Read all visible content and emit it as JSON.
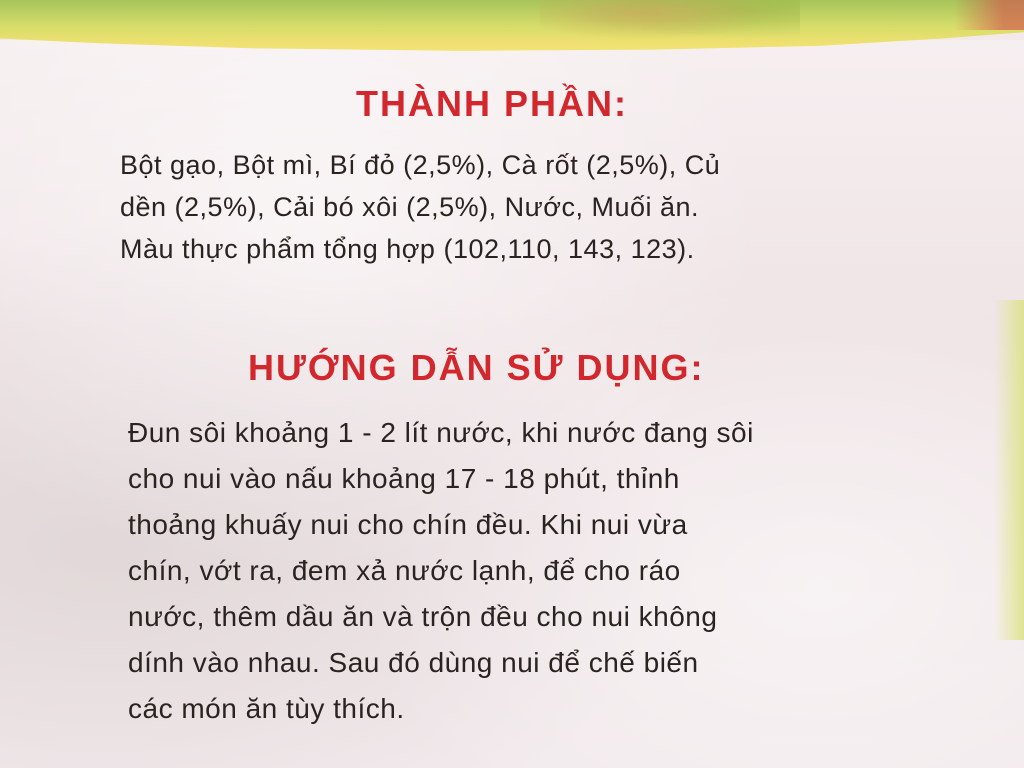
{
  "ingredients": {
    "title": "THÀNH PHẦN:",
    "lines": [
      "Bột gạo, Bột mì, Bí đỏ (2,5%), Cà rốt (2,5%), Củ",
      "dền (2,5%), Cải bó xôi (2,5%), Nước, Muối ăn.",
      "Màu thực phẩm tổng hợp (102,110, 143, 123)."
    ]
  },
  "instructions": {
    "title": "HƯỚNG DẪN SỬ DỤNG:",
    "lines": [
      "Đun sôi khoảng 1 - 2 lít nước, khi nước đang sôi",
      "cho nui vào nấu khoảng 17 - 18 phút, thỉnh",
      "thoảng khuấy nui cho chín đều. Khi nui vừa",
      "chín, vớt ra, đem xả nước lạnh, để cho ráo",
      "nước, thêm dầu ăn và trộn đều cho nui không",
      "dính vào nhau. Sau đó dùng nui để chế biến",
      "các món ăn tùy thích."
    ]
  },
  "colors": {
    "heading": "#d3272e",
    "body_text": "#2a2420",
    "package_background": "#f3e9ea",
    "top_band": "#d6dd6a"
  }
}
